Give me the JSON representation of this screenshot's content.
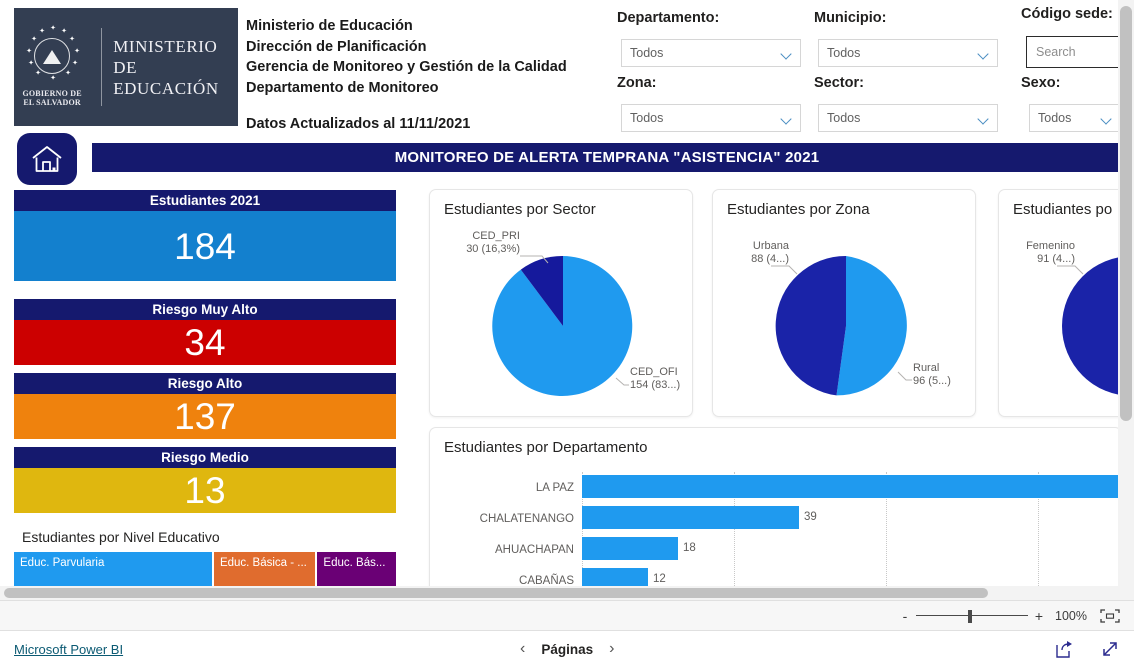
{
  "logo": {
    "crest_line1": "GOBIERNO DE",
    "crest_line2": "EL SALVADOR",
    "name_line1": "MINISTERIO",
    "name_line2": "DE EDUCACIÓN"
  },
  "header": {
    "title_lines": "Ministerio de Educación\nDirección de Planificación\nGerencia de Monitoreo y Gestión de la Calidad\nDepartamento de Monitoreo",
    "update_note": "Datos Actualizados al 11/11/2021",
    "banner_title": "MONITOREO DE ALERTA TEMPRANA \"ASISTENCIA\" 2021",
    "home_icon": "home-icon"
  },
  "slicers": [
    {
      "label": "Departamento:",
      "value": "Todos",
      "type": "dropdown"
    },
    {
      "label": "Municipio:",
      "value": "Todos",
      "type": "dropdown"
    },
    {
      "label": "Código sede:",
      "value": "",
      "placeholder": "Search",
      "type": "search"
    },
    {
      "label": "Zona:",
      "value": "Todos",
      "type": "dropdown"
    },
    {
      "label": "Sector:",
      "value": "Todos",
      "type": "dropdown"
    },
    {
      "label": "Sexo:",
      "value": "Todos",
      "type": "dropdown"
    }
  ],
  "kpis": [
    {
      "title": "Estudiantes 2021",
      "value": "184",
      "color": "#1380ce",
      "header_color": "#15196e"
    },
    {
      "title": "Riesgo Muy Alto",
      "value": "34",
      "color": "#cc0000",
      "header_color": "#15196e"
    },
    {
      "title": "Riesgo Alto",
      "value": "137",
      "color": "#ef820d",
      "header_color": "#15196e"
    },
    {
      "title": "Riesgo Medio",
      "value": "13",
      "color": "#dfb70f",
      "header_color": "#15196e"
    }
  ],
  "nivel_educativo": {
    "title": "Estudiantes por Nivel Educativo",
    "cells": [
      {
        "label": "Educ. Parvularia",
        "color": "#1f9aef",
        "weight": 199
      },
      {
        "label": "Educ. Básica - ...",
        "color": "#e06c2e",
        "weight": 102
      },
      {
        "label": "Educ. Bás...",
        "color": "#6a0075",
        "weight": 79
      }
    ]
  },
  "chart_data": [
    {
      "type": "pie",
      "title": "Estudiantes por Sector",
      "labels": [
        "CED_OFI",
        "CED_PRI"
      ],
      "values": [
        154,
        30
      ],
      "percents": [
        83.7,
        16.3
      ],
      "value_labels": [
        "154 (83...)",
        "30 (16,3%)"
      ],
      "colors": [
        "#1f9aef",
        "#15199c"
      ],
      "legend": "callouts"
    },
    {
      "type": "pie",
      "title": "Estudiantes por Zona",
      "labels": [
        "Rural",
        "Urbana"
      ],
      "values": [
        96,
        88
      ],
      "percents": [
        52.2,
        47.8
      ],
      "value_labels": [
        "96 (5...)",
        "88 (4...)"
      ],
      "colors": [
        "#1f9aef",
        "#1a23a8"
      ],
      "legend": "callouts"
    },
    {
      "type": "pie",
      "title": "Estudiantes po",
      "title_full": "Estudiantes por Sexo",
      "labels": [
        "Femenino"
      ],
      "values": [
        91
      ],
      "value_labels": [
        "91 (4...)"
      ],
      "colors": [
        "#1a23a8"
      ],
      "legend": "callouts",
      "clipped": true
    },
    {
      "type": "bar",
      "orientation": "horizontal",
      "title": "Estudiantes por Departamento",
      "categories": [
        "LA PAZ",
        "CHALATENANGO",
        "AHUACHAPAN",
        "CABAÑAS"
      ],
      "values": [
        96,
        39,
        18,
        12
      ],
      "value_labels": [
        "",
        "39",
        "18",
        "12"
      ],
      "bar_color": "#1f9aef",
      "xlabel": "",
      "ylabel": "",
      "grid": true,
      "clipped": true,
      "note_partial_row": "fifth bar partially visible, cut off"
    }
  ],
  "zoombar": {
    "minus": "-",
    "plus": "+",
    "percent": "100%",
    "fit_icon": "fit-to-page-icon"
  },
  "footer": {
    "brand": "Microsoft Power BI",
    "prev_icon": "chevron-left-icon",
    "pages_label": "Páginas",
    "next_icon": "chevron-right-icon",
    "share_icon": "share-icon",
    "fullscreen_icon": "expand-icon"
  },
  "colors": {
    "navy": "#15196e",
    "light_blue": "#1f9aef",
    "kpi_blue": "#1380ce",
    "red": "#cc0000",
    "orange": "#ef820d",
    "yellow": "#dfb70f",
    "dark_blue_pie": "#15199c",
    "purple": "#6a0075",
    "logo_bg": "#333e52"
  }
}
